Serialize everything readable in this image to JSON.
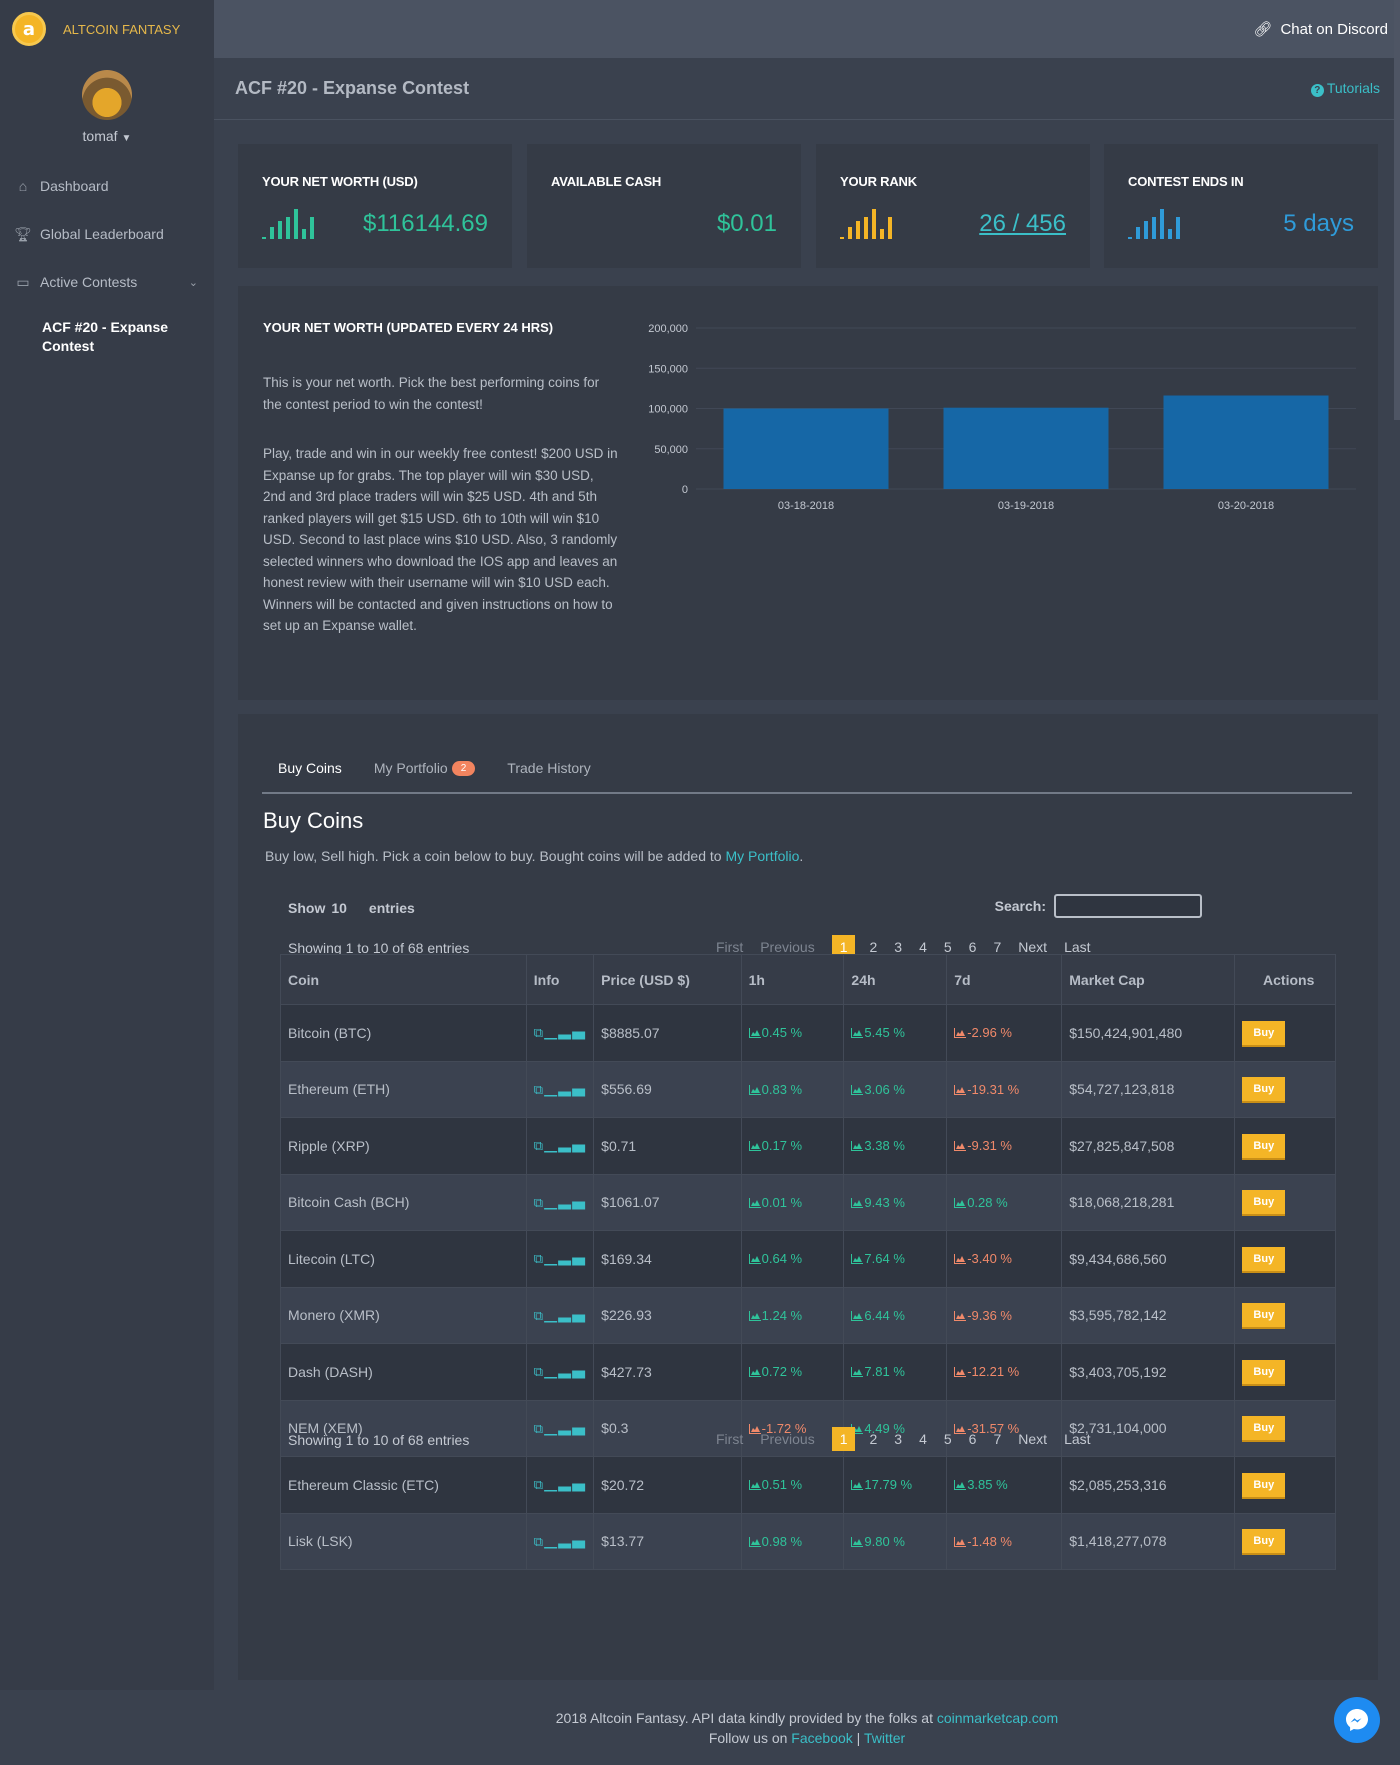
{
  "brand": {
    "name": "ALTCOIN FANTASY",
    "logo_glyph": "a"
  },
  "user": {
    "name": "tomaf"
  },
  "sidebar": {
    "items": [
      {
        "label": "Dashboard",
        "icon": "home-icon"
      },
      {
        "label": "Global Leaderboard",
        "icon": "trophy-icon"
      },
      {
        "label": "Active Contests",
        "icon": "folder-icon"
      }
    ],
    "sub_item": "ACF #20 - Expanse Contest"
  },
  "topbar": {
    "discord": "Chat on Discord"
  },
  "page": {
    "title": "ACF #20 - Expanse Contest",
    "tutorials": "Tutorials"
  },
  "stats": [
    {
      "label": "YOUR NET WORTH (USD)",
      "value": "$116144.69",
      "color": "#2fc39a"
    },
    {
      "label": "AVAILABLE CASH",
      "value": "$0.01",
      "color": "#2fc39a"
    },
    {
      "label": "YOUR RANK",
      "value": "26 / 456",
      "color": "#3bbfc8",
      "spark_color": "#f4b526"
    },
    {
      "label": "CONTEST ENDS IN",
      "value": "5 days",
      "color": "#2f9bd9",
      "spark_color": "#2f9bd9"
    }
  ],
  "networth": {
    "title": "YOUR NET WORTH (UPDATED EVERY 24 HRS)",
    "p1": "This is your net worth. Pick the best performing coins for the contest period to win the contest!",
    "p2": "Play, trade and win in our weekly free contest! $200 USD in Expanse up for grabs. The top player will win $30 USD, 2nd and 3rd place traders will win $25 USD. 4th and 5th ranked players will get $15 USD. 6th to 10th will win $10 USD. Second to last place wins $10 USD. Also, 3 randomly selected winners who download the IOS app and leaves an honest review with their username will win $10 USD each. Winners will be contacted and given instructions on how to set up an Expanse wallet."
  },
  "chart_data": {
    "type": "bar",
    "title": "",
    "categories": [
      "03-18-2018",
      "03-19-2018",
      "03-20-2018"
    ],
    "values": [
      100000,
      101000,
      116145
    ],
    "ylim": [
      0,
      200000
    ],
    "yticks": [
      "0",
      "50,000",
      "100,000",
      "150,000",
      "200,000"
    ],
    "ytick_values": [
      0,
      50000,
      100000,
      150000,
      200000
    ],
    "xlabel": "",
    "ylabel": "",
    "grid": true,
    "bar_color": "#1667a6"
  },
  "tabs": [
    {
      "label": "Buy Coins",
      "active": true
    },
    {
      "label": "My Portfolio",
      "badge": "2"
    },
    {
      "label": "Trade History"
    }
  ],
  "buy": {
    "title": "Buy Coins",
    "subtitle_pre": "Buy low, Sell high. Pick a coin below to buy. Bought coins will be added to ",
    "subtitle_link": "My Portfolio",
    "subtitle_post": ".",
    "show_label": "Show",
    "show_value": "10",
    "entries_label": "entries",
    "search_label": "Search:",
    "search_value": "",
    "showing": "Showing 1 to 10 of 68 entries"
  },
  "pager": {
    "first": "First",
    "prev": "Previous",
    "pages": [
      "1",
      "2",
      "3",
      "4",
      "5",
      "6",
      "7"
    ],
    "current": "1",
    "next": "Next",
    "last": "Last"
  },
  "table": {
    "headers": [
      "Coin",
      "Info",
      "Price (USD $)",
      "1h",
      "24h",
      "7d",
      "Market Cap",
      "Actions"
    ],
    "buy_label": "Buy",
    "rows": [
      {
        "coin": "Bitcoin (BTC)",
        "price": "$8885.07",
        "h1": "0.45 %",
        "h24": "5.45 %",
        "d7": "-2.96 %",
        "cap": "$150,424,901,480"
      },
      {
        "coin": "Ethereum (ETH)",
        "price": "$556.69",
        "h1": "0.83 %",
        "h24": "3.06 %",
        "d7": "-19.31 %",
        "cap": "$54,727,123,818"
      },
      {
        "coin": "Ripple (XRP)",
        "price": "$0.71",
        "h1": "0.17 %",
        "h24": "3.38 %",
        "d7": "-9.31 %",
        "cap": "$27,825,847,508"
      },
      {
        "coin": "Bitcoin Cash (BCH)",
        "price": "$1061.07",
        "h1": "0.01 %",
        "h24": "9.43 %",
        "d7": "0.28 %",
        "cap": "$18,068,218,281"
      },
      {
        "coin": "Litecoin (LTC)",
        "price": "$169.34",
        "h1": "0.64 %",
        "h24": "7.64 %",
        "d7": "-3.40 %",
        "cap": "$9,434,686,560"
      },
      {
        "coin": "Monero (XMR)",
        "price": "$226.93",
        "h1": "1.24 %",
        "h24": "6.44 %",
        "d7": "-9.36 %",
        "cap": "$3,595,782,142"
      },
      {
        "coin": "Dash (DASH)",
        "price": "$427.73",
        "h1": "0.72 %",
        "h24": "7.81 %",
        "d7": "-12.21 %",
        "cap": "$3,403,705,192"
      },
      {
        "coin": "NEM (XEM)",
        "price": "$0.3",
        "h1": "-1.72 %",
        "h24": "4.49 %",
        "d7": "-31.57 %",
        "cap": "$2,731,104,000"
      },
      {
        "coin": "Ethereum Classic (ETC)",
        "price": "$20.72",
        "h1": "0.51 %",
        "h24": "17.79 %",
        "d7": "3.85 %",
        "cap": "$2,085,253,316"
      },
      {
        "coin": "Lisk (LSK)",
        "price": "$13.77",
        "h1": "0.98 %",
        "h24": "9.80 %",
        "d7": "-1.48 %",
        "cap": "$1,418,277,078"
      }
    ]
  },
  "footer": {
    "line1_pre": "2018 Altcoin Fantasy. API data kindly provided by the folks at ",
    "line1_link": "coinmarketcap.com",
    "line2_pre": "Follow us on ",
    "facebook": "Facebook",
    "sep": " | ",
    "twitter": "Twitter"
  },
  "colors": {
    "accent": "#f4b526",
    "link": "#3bbfc8",
    "up": "#2fc39a",
    "down": "#f0896a"
  }
}
